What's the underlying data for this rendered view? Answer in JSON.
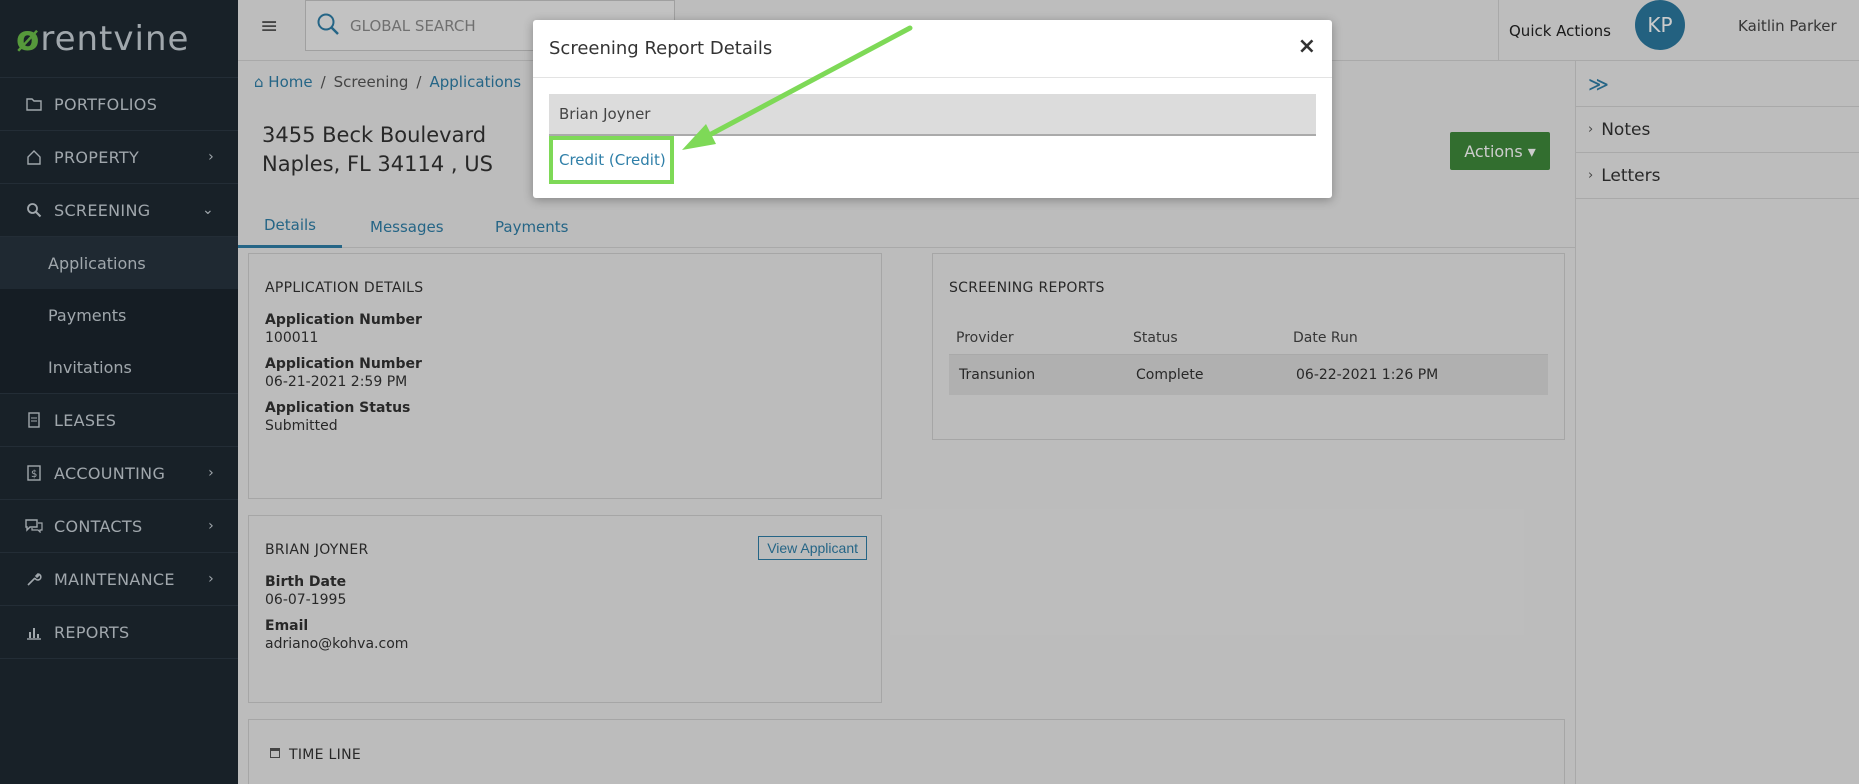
{
  "app": {
    "brand": "rentvine",
    "brand_mark": "ø"
  },
  "sidebar": {
    "items": [
      {
        "label": "PORTFOLIOS"
      },
      {
        "label": "PROPERTY",
        "chevron": "›"
      },
      {
        "label": "SCREENING",
        "chevron": "⌄"
      },
      {
        "label": "LEASES"
      },
      {
        "label": "ACCOUNTING",
        "chevron": "›"
      },
      {
        "label": "CONTACTS",
        "chevron": "›"
      },
      {
        "label": "MAINTENANCE",
        "chevron": "›"
      },
      {
        "label": "REPORTS"
      }
    ],
    "screening_sub": [
      "Applications",
      "Payments",
      "Invitations"
    ]
  },
  "topbar": {
    "search_placeholder": "GLOBAL SEARCH",
    "quick_actions": "Quick Actions",
    "avatar_initials": "KP",
    "user_name": "Kaitlin Parker"
  },
  "breadcrumb": {
    "home": "Home",
    "sep": "/",
    "screening": "Screening",
    "applications": "Applications"
  },
  "header": {
    "address_line1": "3455 Beck Boulevard",
    "address_line2": "Naples, FL 34114 , US",
    "actions": "Actions"
  },
  "tabs": [
    "Details",
    "Messages",
    "Payments"
  ],
  "application_details": {
    "title": "APPLICATION DETAILS",
    "fields": [
      {
        "label": "Application Number",
        "value": "100011"
      },
      {
        "label": "Application Number",
        "value": "06-21-2021 2:59 PM"
      },
      {
        "label": "Application Status",
        "value": "Submitted"
      }
    ]
  },
  "screening_reports": {
    "title": "SCREENING REPORTS",
    "columns": [
      "Provider",
      "Status",
      "Date Run"
    ],
    "rows": [
      [
        "Transunion",
        "Complete",
        "06-22-2021 1:26 PM"
      ]
    ]
  },
  "applicant": {
    "title": "BRIAN JOYNER",
    "view_button": "View Applicant",
    "fields": [
      {
        "label": "Birth Date",
        "value": "06-07-1995"
      },
      {
        "label": "Email",
        "value": "adriano@kohva.com"
      }
    ]
  },
  "timeline": {
    "title": "TIME LINE"
  },
  "right_panel": {
    "items": [
      "Notes",
      "Letters"
    ]
  },
  "modal": {
    "title": "Screening Report Details",
    "close": "×",
    "applicant_name": "Brian Joyner",
    "credit_link": "Credit (Credit)"
  },
  "colors": {
    "sidebar_bg": "#1f2a33",
    "accent_link": "#2f7fa8",
    "actions_green": "#3f8a3b",
    "highlight_green": "#7ed957"
  }
}
